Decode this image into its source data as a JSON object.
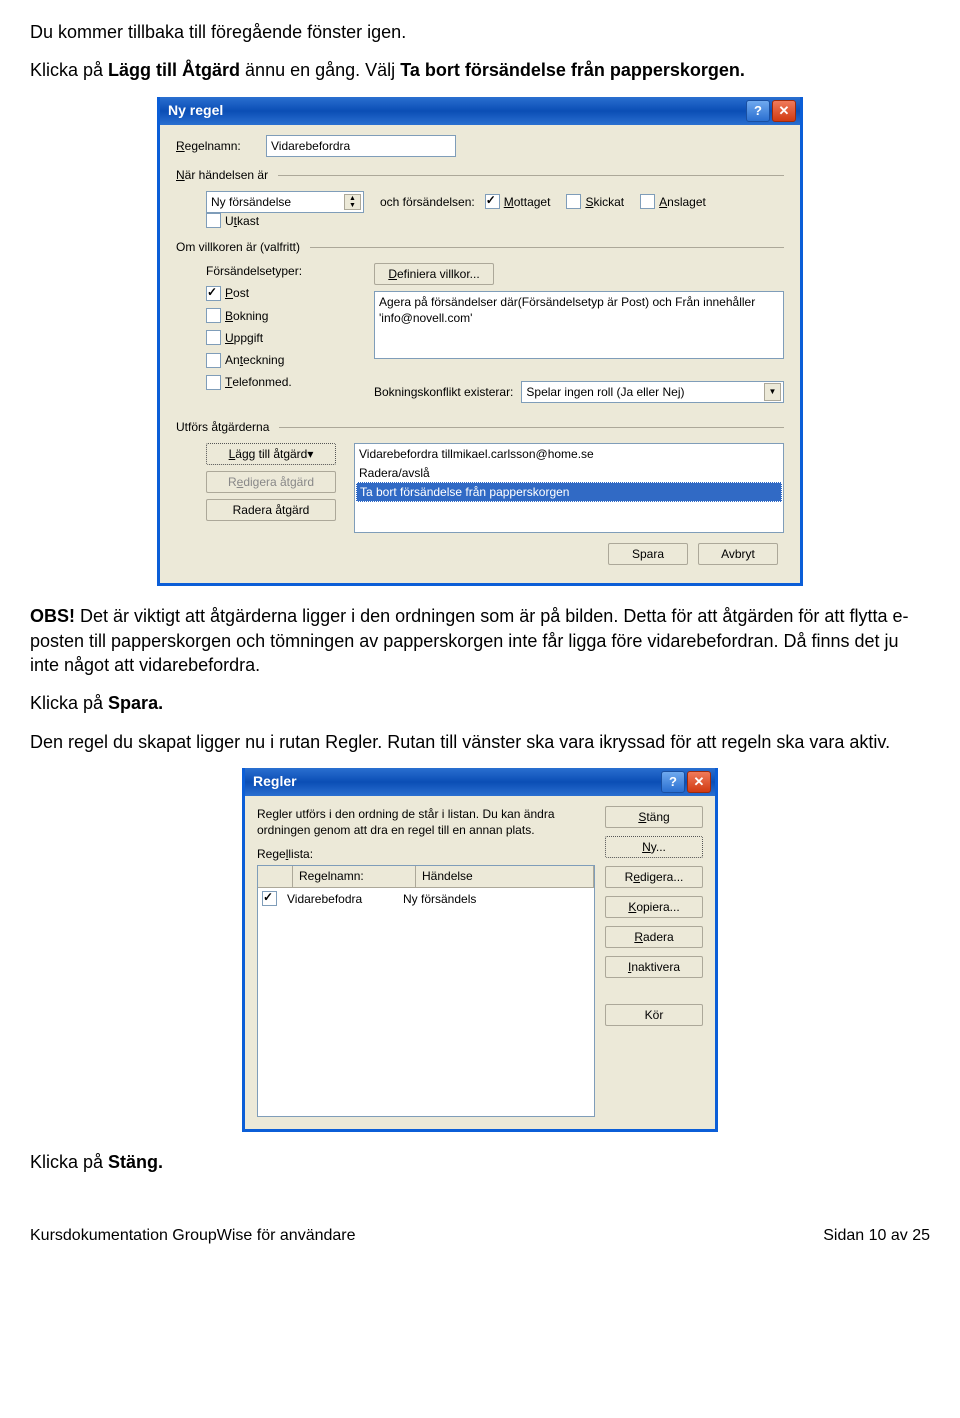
{
  "intro": {
    "p1": "Du kommer tillbaka till föregående fönster igen.",
    "p2a": "Klicka på ",
    "p2b": "Lägg till Åtgärd",
    "p2c": " ännu en gång. Välj ",
    "p2d": "Ta bort försändelse från papperskorgen.",
    "p2e": ""
  },
  "dlg1": {
    "title": "Ny regel",
    "regelnamn_label": "Regelnamn:",
    "regelnamn_value": "Vidarebefordra",
    "nar_label": "När händelsen är",
    "ny_forsandelse": "Ny försändelse",
    "och_forsandelsen": "och försändelsen:",
    "chk_mottaget": "Mottaget",
    "chk_skickat": "Skickat",
    "chk_anslaget": "Anslaget",
    "chk_utkast": "Utkast",
    "om_villkoren": "Om villkoren är (valfritt)",
    "forsandelsetyper": "Försändelsetyper:",
    "t_post": "Post",
    "t_bokning": "Bokning",
    "t_uppgift": "Uppgift",
    "t_anteckning": "Anteckning",
    "t_telefon": "Telefonmed.",
    "definiera": "Definiera villkor...",
    "agera_text": "Agera på försändelser där(Försändelsetyp är Post) och Från  innehåller 'info@novell.com'",
    "bokningskonflikt": "Bokningskonflikt existerar:",
    "bokn_value": "Spelar ingen roll (Ja eller Nej)",
    "utfors": "Utförs åtgärderna",
    "btn_lagg": "Lägg till åtgärd",
    "btn_redigera": "Redigera åtgärd",
    "btn_radera": "Radera åtgärd",
    "action1": "Vidarebefordra tillmikael.carlsson@home.se",
    "action2": "Radera/avslå",
    "action3": "Ta bort försändelse från papperskorgen",
    "spara": "Spara",
    "avbryt": "Avbryt"
  },
  "mid": {
    "obs": "OBS!",
    "obs_text": " Det är viktigt att åtgärderna ligger i den ordningen som är på bilden. Detta för att åtgärden för att flytta e-posten till papperskorgen och tömningen av papperskorgen inte får ligga före vidarebefordran. Då finns det ju inte något att vidarebefordra.",
    "klicka_spara_a": "Klicka på ",
    "klicka_spara_b": "Spara.",
    "p3": "Den regel du skapat ligger nu i rutan Regler. Rutan till vänster ska vara ikryssad för att regeln ska vara aktiv."
  },
  "dlg2": {
    "title": "Regler",
    "desc": "Regler utförs i den ordning de står i listan. Du kan ändra ordningen genom att dra en regel till en annan plats.",
    "regellista": "Regellista:",
    "col1": "Regelnamn:",
    "col2": "Händelse",
    "row_name": "Vidarebefodra",
    "row_event": "Ny försändels",
    "btn_stang": "Stäng",
    "btn_ny": "Ny...",
    "btn_redigera": "Redigera...",
    "btn_kopiera": "Kopiera...",
    "btn_radera": "Radera",
    "btn_inaktivera": "Inaktivera",
    "btn_kor": "Kör"
  },
  "outro": {
    "klicka_stang_a": "Klicka på ",
    "klicka_stang_b": "Stäng."
  },
  "footer": {
    "left": "Kursdokumentation GroupWise för användare",
    "right_a": "Sidan ",
    "right_b": "10 av 25"
  }
}
